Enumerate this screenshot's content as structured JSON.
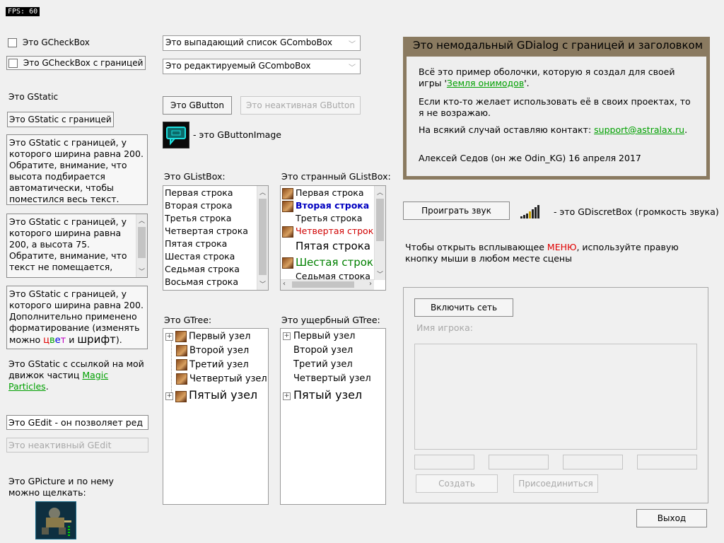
{
  "fps": "FPS: 60",
  "checkbox1": "Это GCheckBox",
  "checkbox2": "Это GCheckBox с границей",
  "static1": "Это GStatic",
  "static2": "Это GStatic с границей",
  "static3": "Это GStatic с границей, у которого ширина равна 200. Обратите, внимание, что высота подбирается автоматически, чтобы поместился весь текст.",
  "static4": "Это GStatic с границей, у которого ширина равна 200, а высота 75. Обратите, внимание, что текст не помещается,",
  "static5": {
    "a": "Это GStatic с границей, у которого ширина равна 200. Дополнительно применено форматирование (изменять можно ",
    "c1": "ц",
    "c2": "в",
    "c3": "е",
    "c4": "т",
    "b": " и ",
    "c": "шрифт",
    "d": ")."
  },
  "static6": {
    "a": "Это GStatic с ссылкой на мой движок частиц ",
    "link": "Magic Particles",
    "b": "."
  },
  "edit1": "Это GEdit - он позволяет ред",
  "edit2": "Это неактивный GEdit",
  "picture_label": "Это GPicture и по нему можно щелкать:",
  "combo1": "Это выпадающий список GComboBox",
  "combo2": "Это редактируемый GComboBox",
  "button1": "Это GButton",
  "button2": "Это неактивная GButton",
  "buttonimage_label": "- это GButtonImage",
  "listbox_label": "Это GListBox:",
  "listbox_items": [
    "Первая строка",
    "Вторая строка",
    "Третья строка",
    "Четвертая строка",
    "Пятая строка",
    "Шестая строка",
    "Седьмая строка",
    "Восьмая строка"
  ],
  "strange_label": "Это странный GListBox:",
  "strange_items": [
    "Первая строка",
    "Вторая строка",
    "Третья строка",
    "Четвертая строк",
    "Пятая строка",
    "Шестая строка",
    "Седьмая строка"
  ],
  "tree_label": "Это GTree:",
  "tree_items": [
    "Первый узел",
    "Второй узел",
    "Третий узел",
    "Четвертый узел",
    "Пятый узел"
  ],
  "tree2_label": "Это ущербный GTree:",
  "tree2_items": [
    "Первый узел",
    "Второй узел",
    "Третий узел",
    "Четвертый узел",
    "Пятый узел"
  ],
  "dialog": {
    "title": "Это немодальный GDialog с границей и заголовком",
    "p1a": "Всё это пример оболочки, которую я создал для своей игры '",
    "p1link": "Земля онимодов",
    "p1b": "'.",
    "p2": "Если кто-то желает использовать её в своих проектах, то я не возражаю.",
    "p3a": "На всякий случай оставляю контакт: ",
    "p3link": "support@astralax.ru",
    "p3b": ".",
    "p4": "Алексей Седов (он же Odin_KG) 16 апреля 2017"
  },
  "play_sound": "Проиграть звук",
  "discret_label": "- это GDiscretBox (громкость звука)",
  "popup": {
    "a": "Чтобы открыть всплывающее ",
    "menu": "МЕНЮ",
    "b": ", используйте правую кнопку мыши в любом месте сцены"
  },
  "network": {
    "enable": "Включить сеть",
    "player_name": "Имя игрока:",
    "create": "Создать",
    "join": "Присоединиться"
  },
  "exit": "Выход",
  "colors": {
    "accent_link": "#00a000",
    "dialog_frame": "#8a7a60",
    "menu_red": "#e00000"
  }
}
